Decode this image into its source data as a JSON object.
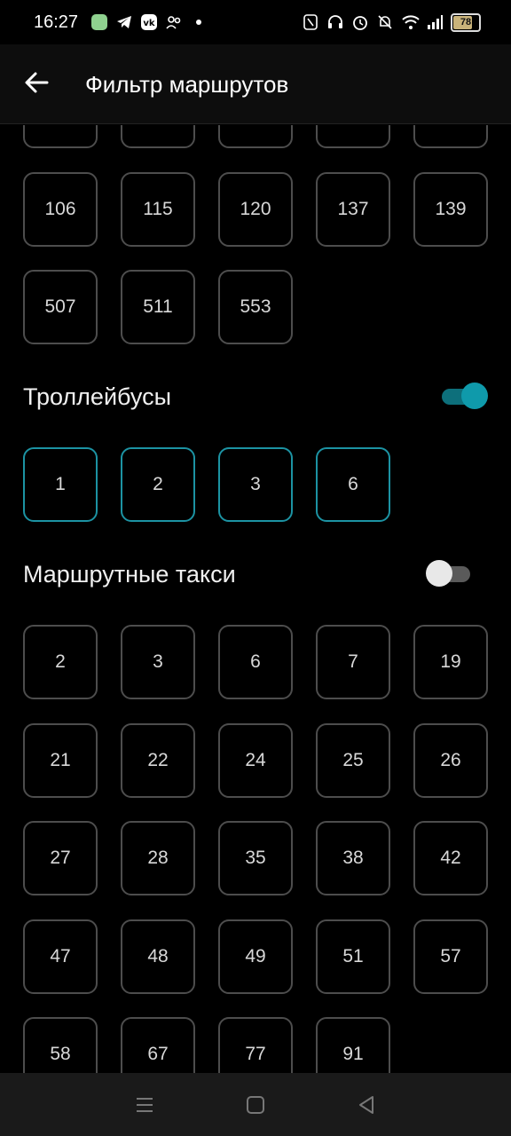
{
  "status_bar": {
    "time": "16:27",
    "battery": "78",
    "left_icons": [
      "app-icon",
      "telegram-icon",
      "vk-icon",
      "people-icon",
      "dot-icon"
    ],
    "right_icons": [
      "nfc-icon",
      "headset-icon",
      "alarm-icon",
      "mute-icon",
      "wifi-icon",
      "signal-icon",
      "battery-icon"
    ]
  },
  "header": {
    "title": "Фильтр маршрутов",
    "back_icon": "arrow-left-icon"
  },
  "colors": {
    "background": "#000000",
    "chip_border": "#4d4d4d",
    "accent": "#0f9aab"
  },
  "buses_partial_rows": [
    [
      "106",
      "115",
      "120",
      "137",
      "139"
    ],
    [
      "507",
      "511",
      "553"
    ]
  ],
  "trolleybuses": {
    "title": "Троллейбусы",
    "enabled": true,
    "routes": [
      "1",
      "2",
      "3",
      "6"
    ]
  },
  "minibuses": {
    "title": "Маршрутные такси",
    "enabled": false,
    "routes": [
      "2",
      "3",
      "6",
      "7",
      "19",
      "21",
      "22",
      "24",
      "25",
      "26",
      "27",
      "28",
      "35",
      "38",
      "42",
      "47",
      "48",
      "49",
      "51",
      "57",
      "58",
      "67",
      "77",
      "91"
    ]
  },
  "nav_bar": {
    "icons": [
      "menu-icon",
      "home-icon",
      "back-icon"
    ]
  }
}
